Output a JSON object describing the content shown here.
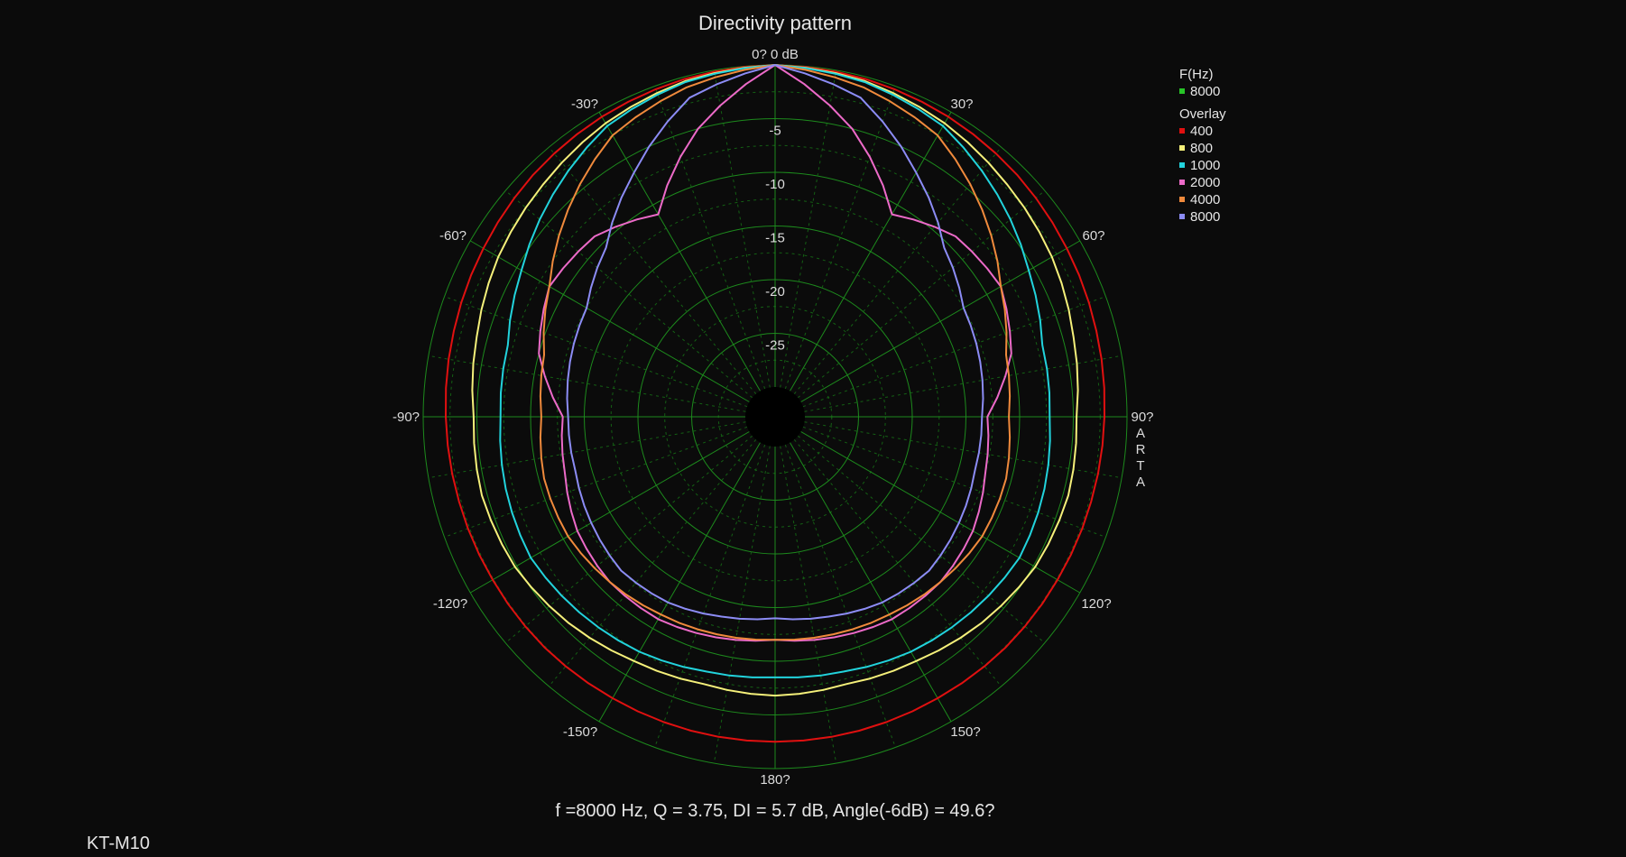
{
  "chart_data": {
    "type": "polar-line",
    "title": "Directivity pattern",
    "top_label": "0? 0 dB",
    "angle_labels": [
      "30?",
      "60?",
      "90?",
      "120?",
      "150?",
      "180?",
      "-150?",
      "-120?",
      "-90?",
      "-60?",
      "-30?"
    ],
    "angle_label_angles": [
      30,
      60,
      90,
      120,
      150,
      180,
      -150,
      -120,
      -90,
      -60,
      -30
    ],
    "radial_labels": [
      "-5",
      "-10",
      "-15",
      "-20",
      "-25"
    ],
    "radial_values": [
      -5,
      -10,
      -15,
      -20,
      -25
    ],
    "r_range": [
      -30,
      0
    ],
    "right_vertical_text": "ARTA",
    "legend": {
      "f_header": "F(Hz)",
      "f_entries": [
        {
          "label": "8000",
          "color": "#27c427"
        }
      ],
      "overlay_header": "Overlay",
      "overlay_entries": [
        {
          "label": "400",
          "color": "#e01010"
        },
        {
          "label": "800",
          "color": "#f5f07a"
        },
        {
          "label": "1000",
          "color": "#22d3dc"
        },
        {
          "label": "2000",
          "color": "#ec6ac8"
        },
        {
          "label": "4000",
          "color": "#f08a3c"
        },
        {
          "label": "8000",
          "color": "#8c8cf5"
        }
      ]
    },
    "angles": [
      0,
      15,
      30,
      45,
      60,
      75,
      90,
      105,
      120,
      135,
      150,
      165,
      180
    ],
    "series": [
      {
        "name": "400",
        "color": "#e01010",
        "values": [
          0,
          -0.2,
          -0.5,
          -0.9,
          -1.4,
          -1.8,
          -2.1,
          -2.3,
          -2.4,
          -2.4,
          -2.5,
          -2.5,
          -2.5
        ]
      },
      {
        "name": "800",
        "color": "#f5f07a",
        "values": [
          0,
          -0.4,
          -1.2,
          -2.2,
          -3.0,
          -4.0,
          -4.7,
          -4.5,
          -4.8,
          -5.6,
          -6.5,
          -7.0,
          -6.8
        ]
      },
      {
        "name": "1000",
        "color": "#22d3dc",
        "values": [
          0,
          -0.5,
          -1.5,
          -3.5,
          -5.5,
          -7.0,
          -7.2,
          -6.8,
          -6.5,
          -7.0,
          -7.5,
          -8.2,
          -8.5
        ]
      },
      {
        "name": "2000",
        "color": "#ec6ac8",
        "values": [
          0,
          -5.0,
          -11.0,
          -9.0,
          -8.5,
          -10.0,
          -13.0,
          -12.5,
          -11.5,
          -11.0,
          -11.0,
          -11.5,
          -12.0
        ]
      },
      {
        "name": "4000",
        "color": "#f08a3c",
        "values": [
          0,
          -1.0,
          -2.5,
          -5.5,
          -8.5,
          -10.5,
          -11.0,
          -10.5,
          -10.5,
          -11.0,
          -11.5,
          -11.8,
          -12.0
        ]
      },
      {
        "name": "8000",
        "color": "#8c8cf5",
        "values": [
          0,
          -2.0,
          -6.5,
          -10.5,
          -12.5,
          -13.0,
          -13.5,
          -13.5,
          -13.0,
          -12.5,
          -12.8,
          -13.5,
          -14.0
        ]
      }
    ],
    "footer": "f =8000 Hz,  Q =  3.75,  DI =   5.7 dB, Angle(-6dB) =  49.6?",
    "model_label": "KT-M10"
  }
}
